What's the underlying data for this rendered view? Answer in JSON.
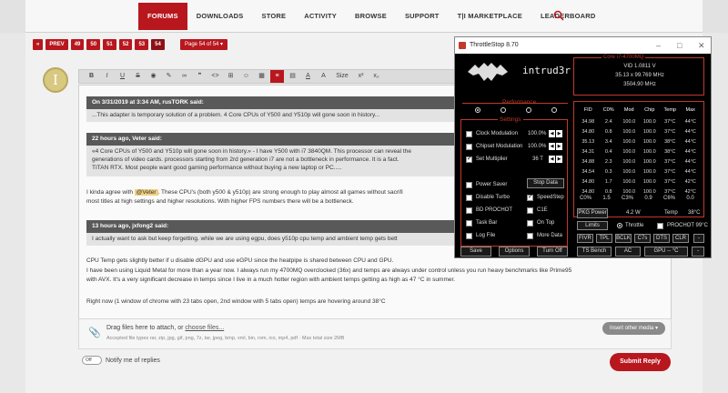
{
  "nav": {
    "items": [
      "FORUMS",
      "DOWNLOADS",
      "STORE",
      "ACTIVITY",
      "BROWSE",
      "SUPPORT",
      "T|I MARKETPLACE",
      "LEADERBOARD"
    ],
    "active_index": 0
  },
  "pager": {
    "prev": "PREV",
    "pages": [
      "49",
      "50",
      "51",
      "52",
      "53",
      "54"
    ],
    "current": "54",
    "page_of": "Page 54 of 54"
  },
  "avatar_letter": "I",
  "toolbar": {
    "buttons": [
      "B",
      "I",
      "U",
      "S",
      "◉",
      "✎",
      "∞",
      "❞",
      "<>",
      "⊞",
      "☺",
      "▦",
      "≡",
      "▤",
      "A",
      "A",
      "Size",
      "x²",
      "x₂"
    ]
  },
  "editor": {
    "quote1_head": "On 3/31/2019 at 3:34 AM, rusTORK said:",
    "quote1_body": "...This adapter is temporary solution of a problem. 4 Core CPUs of Y500 and Y510p will gone soon in history...",
    "quote2_head": "22 hours ago, Veter said:",
    "quote2_line1": "«4 Core CPUs of Y500 and Y510p will gone soon in history.» - I have Y500 with i7 3840QM. This processor can reveal the",
    "quote2_line2": "generations of video cards. processors starting from 2rd generation i7 are not a bottleneck in performance. It is a fact.",
    "quote2_line3": "TITAN RTX. Most people want good gaming performance without buying a new laptop or PC.....",
    "reply_line1_a": "I kinda agree with ",
    "reply_mention": "@Veter",
    "reply_line1_b": ". These CPU's (both y500 & y510p) are strong enough to play almost all games without sacrifi",
    "reply_line2": "most titles at high settings and higher resolutions. With higher FPS numbers there will be a bottleneck.",
    "quote3_head": "13 hours ago, jxfong2 said:",
    "quote3_body": "I actually want to ask but keep forgetting. while we are using egpu, does y510p cpu temp and ambient temp gets bett",
    "p1": "CPU Temp gets slightly better if u disable dGPU and use eGPU since the heatpipe is shared between CPU and GPU.",
    "p2": "I have been using Liquid Metal for more than a year now. I always run my 4700MQ overclocked (36x) and temps are always under control unless you run heavy benchmarks like Prime95",
    "p3": "with AVX. It's a very significant decrease in temps since I live in a much hotter region with ambient temps getting as high as 47 °C in summer.",
    "p4": "Right now (1 window of chrome with 23 tabs open, 2nd window with 5 tabs open) temps are hovering around 38°C"
  },
  "attach": {
    "drag_text": "Drag files here to attach, or ",
    "choose_files": "choose files...",
    "accepted": "Accepted file types rar, zip, jpg, gif, png, 7z, tar, jpeg, bmp, xml, bin, rom, ico, mp4, pdf · Max total size 2MB",
    "insert_media": "Insert other media ▾"
  },
  "notify_label": "Notify me of replies",
  "toggle_label": "Off",
  "submit_label": "Submit Reply",
  "throttlestop": {
    "title": "ThrottleStop 8.70",
    "hostname": "intrud3r",
    "cpu_label": "Core i7-4700MQ",
    "vid": "VID  1.0811 V",
    "mult": "35.13 x 99.769 MHz",
    "freq": "3504.90 MHz",
    "performance_label": "Performance",
    "settings_label": "Settings",
    "settings": [
      {
        "label": "Clock Modulation",
        "value": "100.0%",
        "checked": false
      },
      {
        "label": "Chipset Modulation",
        "value": "100.0%",
        "checked": false
      },
      {
        "label": "Set Multiplier",
        "value": "36 T",
        "checked": true
      }
    ],
    "checks_left": [
      {
        "label": "Power Saver",
        "checked": false
      },
      {
        "label": "Disable Turbo",
        "checked": false
      },
      {
        "label": "BD PROCHOT",
        "checked": false
      },
      {
        "label": "Task Bar",
        "checked": false
      },
      {
        "label": "Log File",
        "checked": false
      }
    ],
    "checks_right": [
      {
        "label": "SpeedStep",
        "checked": true
      },
      {
        "label": "C1E",
        "checked": false
      },
      {
        "label": "On Top",
        "checked": false
      },
      {
        "label": "More Data",
        "checked": false
      }
    ],
    "stop_data": "Stop Data",
    "columns": [
      "FID",
      "C0%",
      "Mod",
      "Chip",
      "Temp",
      "Max"
    ],
    "rows": [
      [
        "34.98",
        "2.4",
        "100.0",
        "100.0",
        "37°C",
        "44°C"
      ],
      [
        "34.80",
        "0.8",
        "100.0",
        "100.0",
        "37°C",
        "44°C"
      ],
      [
        "35.13",
        "3.4",
        "100.0",
        "100.0",
        "38°C",
        "44°C"
      ],
      [
        "34.31",
        "0.4",
        "100.0",
        "100.0",
        "38°C",
        "44°C"
      ],
      [
        "34.88",
        "2.3",
        "100.0",
        "100.0",
        "37°C",
        "44°C"
      ],
      [
        "34.54",
        "0.3",
        "100.0",
        "100.0",
        "37°C",
        "44°C"
      ],
      [
        "34.80",
        "1.7",
        "100.0",
        "100.0",
        "37°C",
        "42°C"
      ],
      [
        "34.80",
        "0.8",
        "100.0",
        "100.0",
        "37°C",
        "42°C"
      ]
    ],
    "summary": [
      "C0%",
      "1.5",
      "C3%",
      "0.9",
      "C6%",
      "0.0"
    ],
    "pkg_power_label": "PKG Power",
    "pkg_power_value": "4.2 W",
    "temp_label": "Temp",
    "temp_value": "38°C",
    "limits": "Limits",
    "throttle": "Throttle",
    "prochot": "PROCHOT 99°C",
    "small_buttons": [
      "FIVR",
      "TPL",
      "BCLK",
      "C7s",
      "DTS",
      "CLR",
      "-"
    ],
    "bottom_buttons": [
      "Save",
      "Options",
      "Turn Off",
      "TS Bench",
      "AC",
      "GPU -- °C",
      "-"
    ]
  }
}
